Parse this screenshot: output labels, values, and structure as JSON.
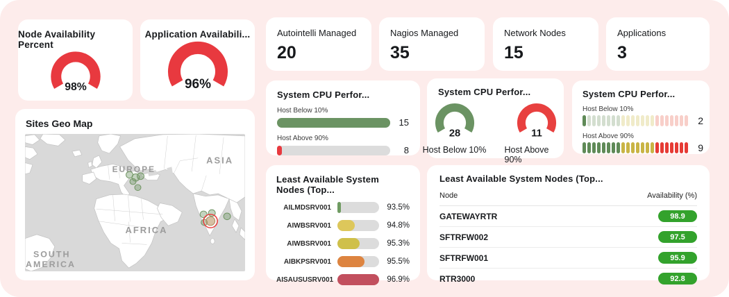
{
  "theme": {
    "board_bg": "#fdeceb",
    "card_bg": "#ffffff",
    "text": "#17191c",
    "track": "#dcdcdc",
    "red": "#e8393f",
    "green": "#6b9363"
  },
  "gauge_cards": [
    {
      "title": "Node Availability Percent",
      "value": "98%",
      "color": "#e8393f"
    },
    {
      "title": "Application Availabili...",
      "value": "96%",
      "color": "#e8393f"
    }
  ],
  "stat_cards": [
    {
      "label": "Autointelli Managed",
      "value": "20"
    },
    {
      "label": "Nagios Managed",
      "value": "35"
    },
    {
      "label": "Network Nodes",
      "value": "15"
    },
    {
      "label": "Applications",
      "value": "3"
    }
  ],
  "map": {
    "title": "Sites Geo Map",
    "region_labels": [
      "EUROPE",
      "ASIA",
      "AFRICA",
      "SOUTH",
      "AMERICA"
    ]
  },
  "cpu_bars": {
    "title": "System CPU Perfor...",
    "rows": [
      {
        "label": "Host Below 10%",
        "value": "15",
        "pct": 100,
        "color": "#6b9363"
      },
      {
        "label": "Host Above 90%",
        "value": "8",
        "pct": 4,
        "color": "#e8393f"
      }
    ]
  },
  "cpu_gauges": {
    "title": "System CPU Perfor...",
    "gauges": [
      {
        "label": "Host Below 10%",
        "value": "28",
        "color": "#6b9363"
      },
      {
        "label": "Host Above 90%",
        "value": "11",
        "color": "#e8403f"
      }
    ]
  },
  "cpu_dots": {
    "title": "System CPU Perfor...",
    "segments": 22,
    "bands": [
      8,
      7,
      7
    ],
    "lit_colors": [
      "#5f8a57",
      "#c9b445",
      "#e63b35"
    ],
    "pale_colors": [
      "#d3decf",
      "#f0ebc9",
      "#f8cfc9"
    ],
    "rows": [
      {
        "label": "Host Below 10%",
        "value": "2",
        "lit": 1
      },
      {
        "label": "Host Above 90%",
        "value": "9",
        "lit": 22
      }
    ]
  },
  "least_bars": {
    "title": "Least Available System Nodes (Top...",
    "rows": [
      {
        "label": "AILMDSRV001",
        "value": "93.5%",
        "pct": 8,
        "color": "#6f9b62"
      },
      {
        "label": "AIWBSRV001",
        "value": "94.8%",
        "pct": 41,
        "color": "#ddc75b"
      },
      {
        "label": "AIWBSRV001",
        "value": "95.3%",
        "pct": 53,
        "color": "#cfc04a"
      },
      {
        "label": "AIBKPSRV001",
        "value": "95.5%",
        "pct": 65,
        "color": "#dd8440"
      },
      {
        "label": "AISAUSUSRV001",
        "value": "96.9%",
        "pct": 100,
        "color": "#c24f5e"
      }
    ]
  },
  "least_table": {
    "title": "Least Available System Nodes (Top...",
    "columns": [
      "Node",
      "Availability (%)"
    ],
    "badge_color": "#33a22c",
    "rows": [
      {
        "node": "GATEWAYRTR",
        "availability": "98.9"
      },
      {
        "node": "SFTRFW002",
        "availability": "97.5"
      },
      {
        "node": "SFTRFW001",
        "availability": "95.9"
      },
      {
        "node": "RTR3000",
        "availability": "92.8"
      }
    ]
  },
  "chart_data": [
    {
      "type": "gauge",
      "title": "Node Availability Percent",
      "value": 98,
      "unit": "%"
    },
    {
      "type": "gauge",
      "title": "Application Availability",
      "value": 96,
      "unit": "%"
    },
    {
      "type": "stat",
      "title": "Autointelli Managed",
      "value": 20
    },
    {
      "type": "stat",
      "title": "Nagios Managed",
      "value": 35
    },
    {
      "type": "stat",
      "title": "Network Nodes",
      "value": 15
    },
    {
      "type": "stat",
      "title": "Applications",
      "value": 3
    },
    {
      "type": "bar",
      "title": "System CPU Performance (bars)",
      "categories": [
        "Host Below 10%",
        "Host Above 90%"
      ],
      "values": [
        15,
        8
      ]
    },
    {
      "type": "gauge",
      "title": "System CPU Performance (gauges)",
      "series": [
        {
          "name": "Host Below 10%",
          "value": 28
        },
        {
          "name": "Host Above 90%",
          "value": 11
        }
      ]
    },
    {
      "type": "bar",
      "title": "System CPU Performance (segments)",
      "categories": [
        "Host Below 10%",
        "Host Above 90%"
      ],
      "values": [
        2,
        9
      ]
    },
    {
      "type": "bar",
      "title": "Least Available System Nodes (Top)",
      "categories": [
        "AILMDSRV001",
        "AIWBSRV001",
        "AIWBSRV001",
        "AIBKPSRV001",
        "AISAUSUSRV001"
      ],
      "values": [
        93.5,
        94.8,
        95.3,
        95.5,
        96.9
      ],
      "unit": "%"
    },
    {
      "type": "table",
      "title": "Least Available System Nodes (Top)",
      "columns": [
        "Node",
        "Availability (%)"
      ],
      "rows": [
        [
          "GATEWAYRTR",
          98.9
        ],
        [
          "SFTRFW002",
          97.5
        ],
        [
          "SFTRFW001",
          95.9
        ],
        [
          "RTR3000",
          92.8
        ]
      ]
    }
  ]
}
